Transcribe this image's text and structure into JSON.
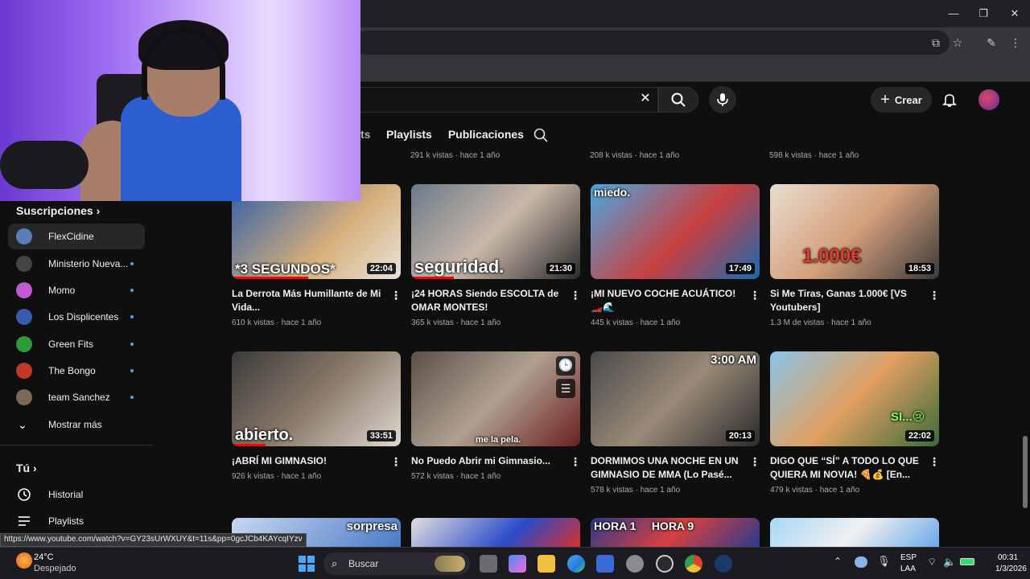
{
  "header": {
    "crear_label": "Crear"
  },
  "channel_tabs": [
    "ts",
    "Playlists",
    "Publicaciones"
  ],
  "top_row_meta": [
    {
      "views": "291 k vistas",
      "age": "hace 1 año"
    },
    {
      "views": "208 k vistas",
      "age": "hace 1 año"
    },
    {
      "views": "598 k vistas",
      "age": "hace 1 año"
    }
  ],
  "sidebar": {
    "subscriptions_heading": "Suscripciones",
    "subscriptions": [
      {
        "name": "FlexCidine",
        "color": "#5a7fb8",
        "new": false
      },
      {
        "name": "Ministerio Nueva...",
        "color": "#444",
        "new": true
      },
      {
        "name": "Momo",
        "color": "#c25ad6",
        "new": true
      },
      {
        "name": "Los Displicentes",
        "color": "#3a5ab0",
        "new": true
      },
      {
        "name": "Green Fits",
        "color": "#2f9a3a",
        "new": true
      },
      {
        "name": "The Bongo",
        "color": "#c0392b",
        "new": true
      },
      {
        "name": "team Sanchez",
        "color": "#7a6a55",
        "new": true
      }
    ],
    "show_more": "Mostrar más",
    "you_heading": "Tú",
    "you_items": [
      "Historial",
      "Playlists"
    ]
  },
  "videos": [
    {
      "title": "La Derrota Más Humillante de Mi Vida...",
      "views": "610 k vistas",
      "age": "hace 1 año",
      "duration": "22:04",
      "overlay": "*3 SEGUNDOS*",
      "bg": "linear-gradient(135deg,#2f5fa8,#d8b07a 60%,#e8e2dc)",
      "progress": 0.45
    },
    {
      "title": "¡24 HORAS Siendo ESCOLTA de OMAR MONTES!",
      "views": "365 k vistas",
      "age": "hace 1 año",
      "duration": "21:30",
      "overlay": "seguridad.",
      "bg": "linear-gradient(135deg,#6a7a8a,#c9b8a8 50%,#2a2a2a)",
      "progress": 0.25
    },
    {
      "title": "¡MI NUEVO COCHE ACUÁTICO! 🏎️🌊",
      "views": "445 k vistas",
      "age": "hace 1 año",
      "duration": "17:49",
      "overlay": "miedo.",
      "bg": "linear-gradient(135deg,#4aa8e0,#c84040 55%,#1a6ab0)",
      "progress": 0
    },
    {
      "title": "Si Me Tiras, Ganas 1.000€ [VS Youtubers]",
      "views": "1.3 M de vistas",
      "age": "hace 1 año",
      "duration": "18:53",
      "overlay": "1.000€",
      "bg": "linear-gradient(135deg,#e8ddd0,#d4a07a 50%,#3a3a3a)",
      "progress": 0
    },
    {
      "title": "¡ABRÍ MI GIMNASIO!",
      "views": "926 k vistas",
      "age": "hace 1 año",
      "duration": "33:51",
      "overlay": "abierto.",
      "bg": "linear-gradient(135deg,#3a3a3a,#8a7a6a 50%,#e0d8d0)",
      "progress": 0.2
    },
    {
      "title": "No Puedo Abrir mi Gimnasio...",
      "views": "572 k vistas",
      "age": "hace 1 año",
      "duration": "",
      "overlay": "me la pela.",
      "bg": "linear-gradient(135deg,#5a5048,#b0a090 50%,#6a2020)",
      "progress": 0
    },
    {
      "title": "DORMIMOS UNA NOCHE EN UN GIMNASIO DE MMA (Lo Pasé...",
      "views": "578 k vistas",
      "age": "hace 1 año",
      "duration": "20:13",
      "overlay": "3:00 AM",
      "bg": "linear-gradient(135deg,#4a4a4a,#9a8a78 50%,#2a2a2a)",
      "progress": 0
    },
    {
      "title": "DIGO QUE “SÍ” A TODO LO QUE QUIERA MI NOVIA! 🍕💰 [En...",
      "views": "479 k vistas",
      "age": "hace 1 año",
      "duration": "22:02",
      "overlay": "SI...😢",
      "bg": "linear-gradient(135deg,#8ac4e8,#e0a060 50%,#3a6a3a)",
      "progress": 0
    }
  ],
  "bottom_row_overlays": [
    "sorpresa",
    "",
    "HORA 1     HORA 9",
    ""
  ],
  "status_url": "https://www.youtube.com/watch?v=GY23sUrWXUY&t=11s&pp=0gcJCb4KAYcqIYzv",
  "taskbar": {
    "weather_temp": "24°C",
    "weather_desc": "Despejado",
    "search_label": "Buscar",
    "lang": "ESP",
    "lang2": "LAA",
    "time": "00:31",
    "date": "1/3/2026"
  }
}
